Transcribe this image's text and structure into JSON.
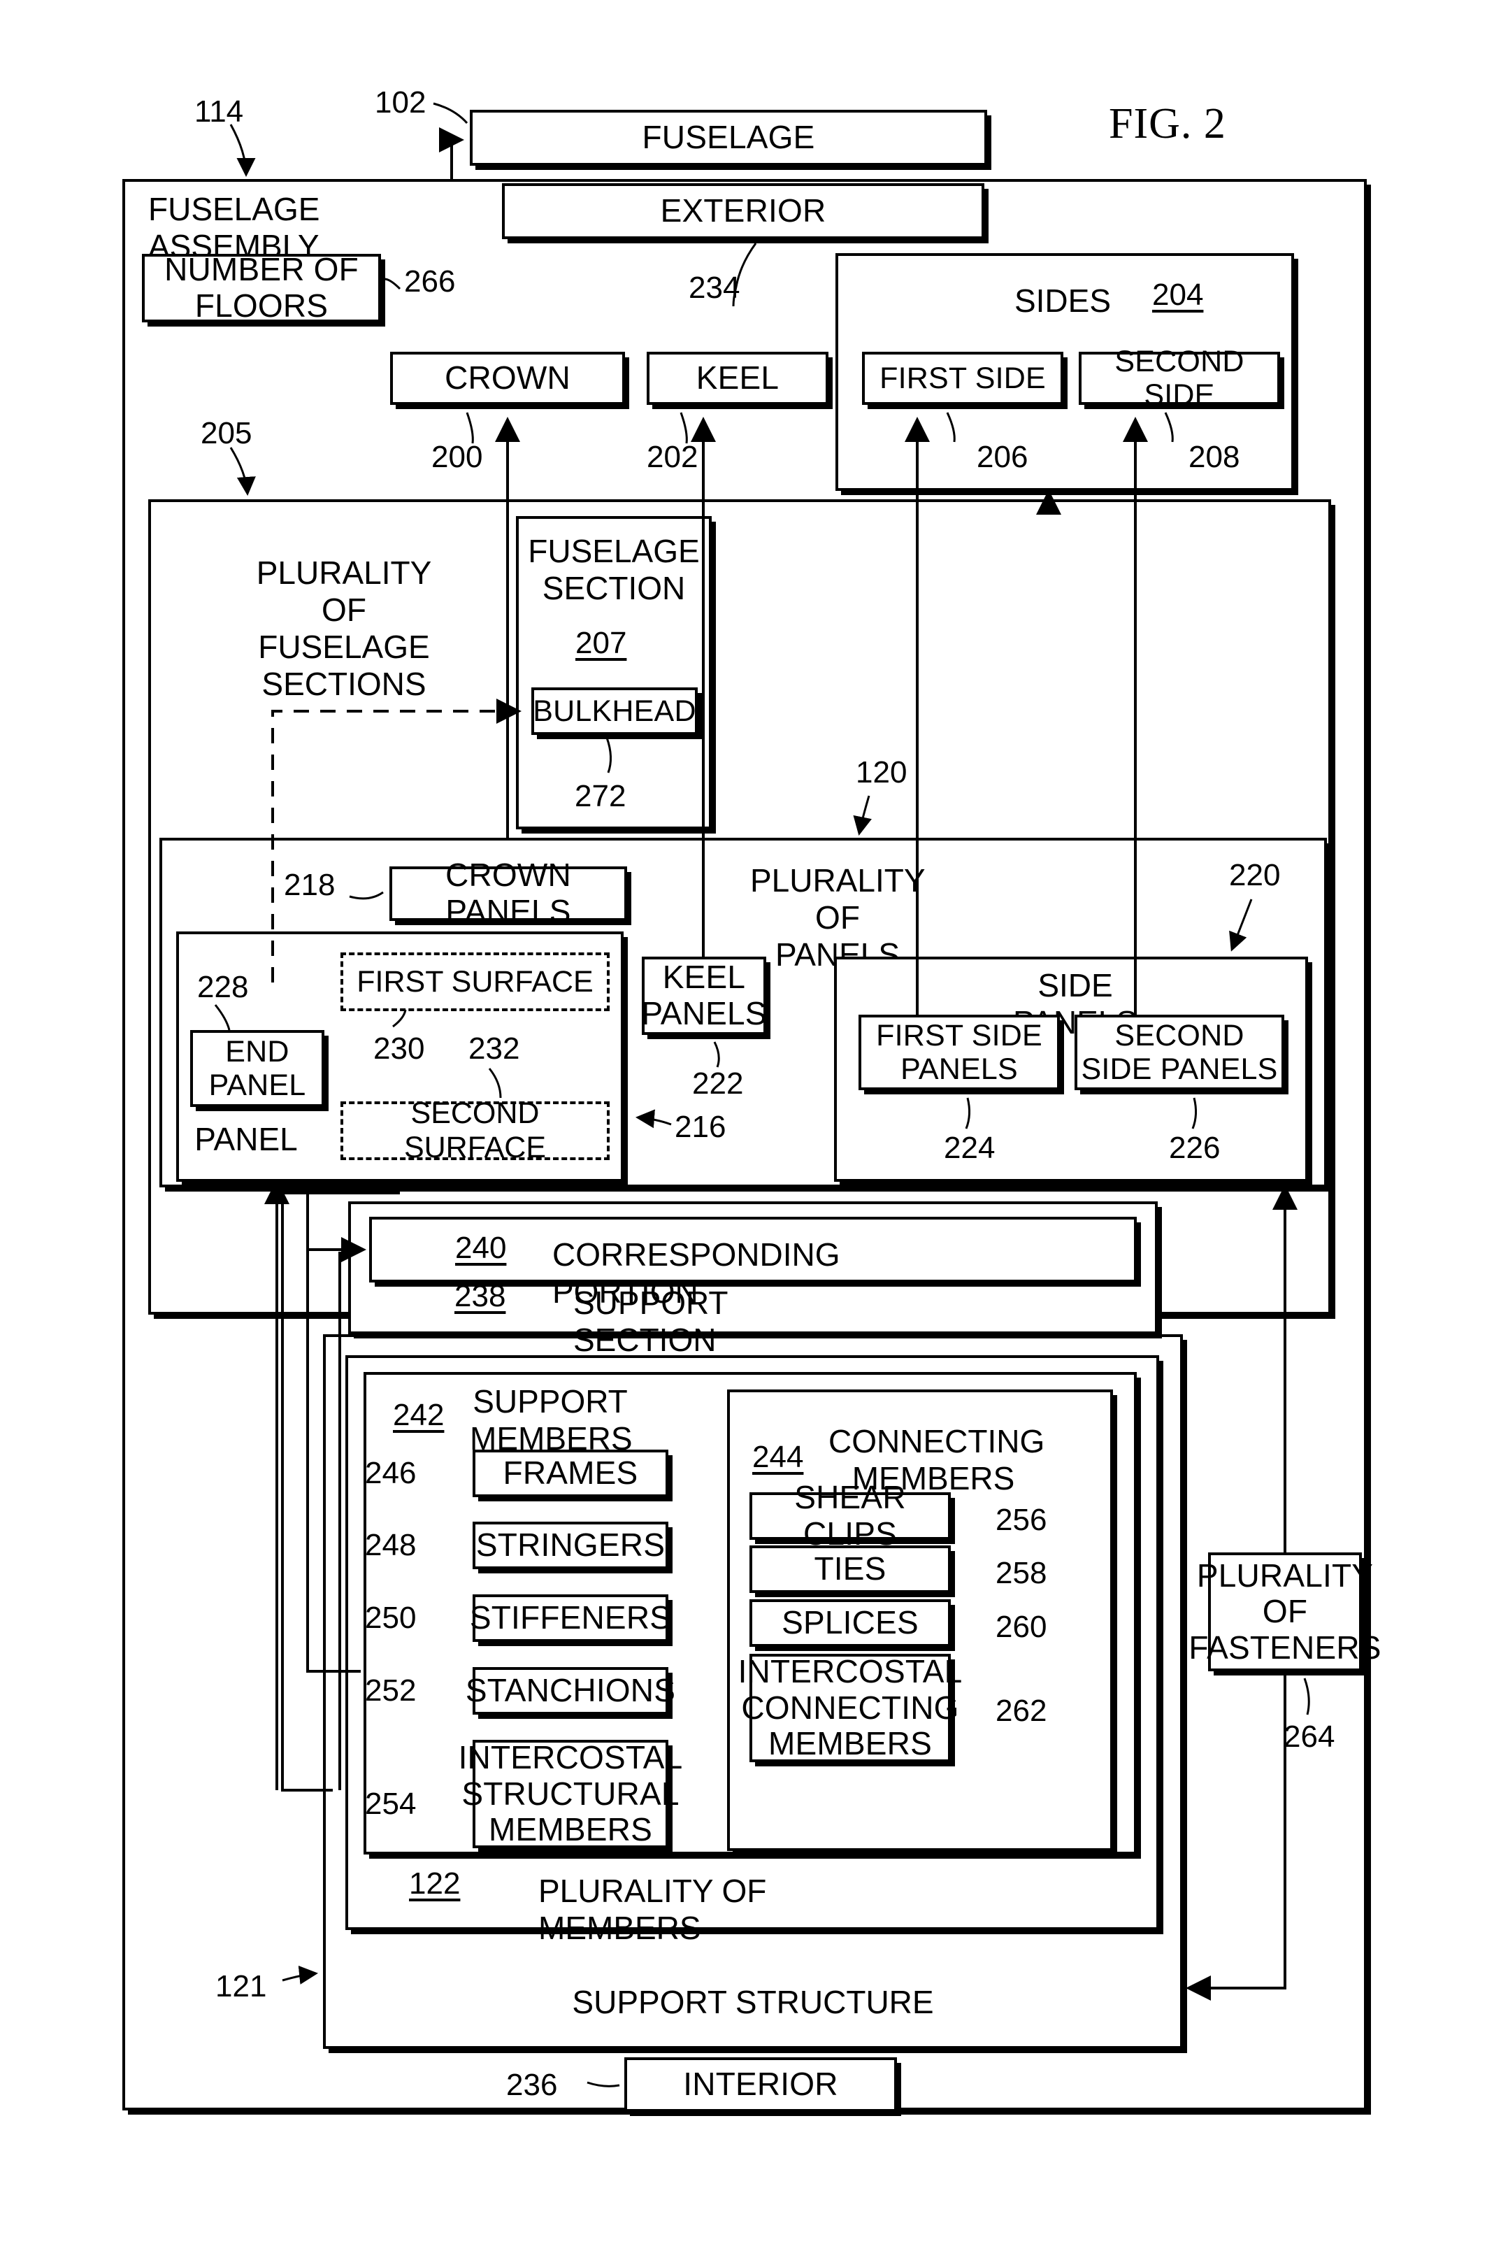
{
  "figure": {
    "title": "FIG. 2"
  },
  "refs": {
    "r114": "114",
    "r102": "102",
    "r266": "266",
    "r234": "234",
    "r204": "204",
    "r200": "200",
    "r202": "202",
    "r206": "206",
    "r208": "208",
    "r205": "205",
    "r207": "207",
    "r272": "272",
    "r120": "120",
    "r218": "218",
    "r220": "220",
    "r228": "228",
    "r230": "230",
    "r232": "232",
    "r216": "216",
    "r222": "222",
    "r224": "224",
    "r226": "226",
    "r240": "240",
    "r238": "238",
    "r242": "242",
    "r244": "244",
    "r246": "246",
    "r248": "248",
    "r250": "250",
    "r252": "252",
    "r254": "254",
    "r256": "256",
    "r258": "258",
    "r260": "260",
    "r262": "262",
    "r264": "264",
    "r122": "122",
    "r121": "121",
    "r236": "236"
  },
  "boxes": {
    "fuselage": "FUSELAGE",
    "fuselage_assembly": "FUSELAGE ASSEMBLY",
    "exterior": "EXTERIOR",
    "number_of_floors": "NUMBER OF\nFLOORS",
    "crown": "CROWN",
    "keel": "KEEL",
    "sides": "SIDES",
    "first_side": "FIRST SIDE",
    "second_side": "SECOND SIDE",
    "plurality_of_fuselage_sections": "PLURALITY\nOF FUSELAGE\nSECTIONS",
    "fuselage_section": "FUSELAGE\nSECTION",
    "bulkhead": "BULKHEAD",
    "plurality_of_panels": "PLURALITY\nOF PANELS",
    "crown_panels": "CROWN PANELS",
    "keel_panels": "KEEL\nPANELS",
    "side_panels": "SIDE PANELS",
    "first_side_panels": "FIRST SIDE\nPANELS",
    "second_side_panels": "SECOND\nSIDE PANELS",
    "panel": "PANEL",
    "end_panel": "END\nPANEL",
    "first_surface": "FIRST SURFACE",
    "second_surface": "SECOND SURFACE",
    "corresponding_portion": "CORRESPONDING PORTION",
    "support_section": "SUPPORT SECTION",
    "support_members": "SUPPORT\nMEMBERS",
    "connecting_members": "CONNECTING\nMEMBERS",
    "frames": "FRAMES",
    "stringers": "STRINGERS",
    "stiffeners": "STIFFENERS",
    "stanchions": "STANCHIONS",
    "intercostal_structural_members": "INTERCOSTAL\nSTRUCTURAL\nMEMBERS",
    "shear_clips": "SHEAR CLIPS",
    "ties": "TIES",
    "splices": "SPLICES",
    "intercostal_connecting_members": "INTERCOSTAL\nCONNECTING\nMEMBERS",
    "plurality_of_fasteners": "PLURALITY\nOF\nFASTENERS",
    "plurality_of_members": "PLURALITY OF MEMBERS",
    "support_structure": "SUPPORT STRUCTURE",
    "interior": "INTERIOR"
  }
}
